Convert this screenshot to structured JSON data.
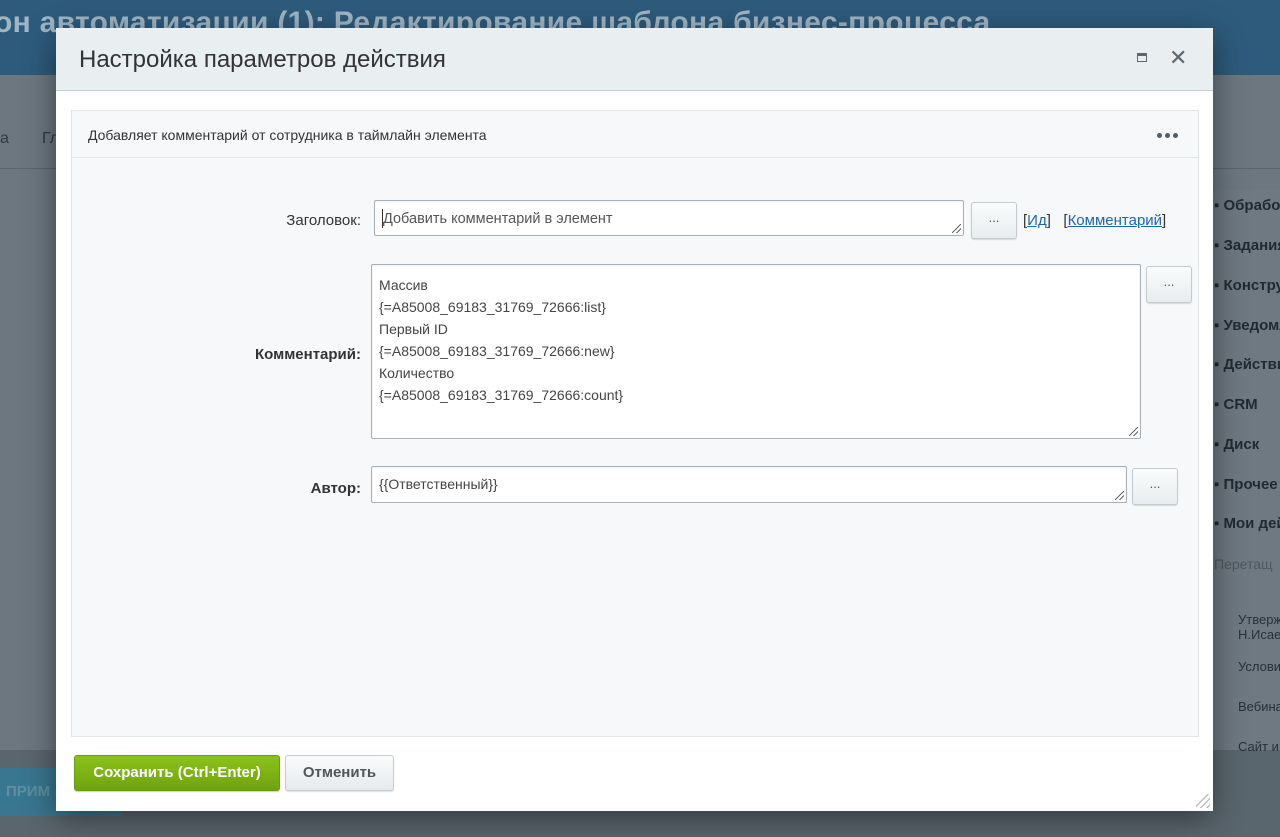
{
  "background": {
    "page_title": "он автоматизации (1): Редактирование шаблона бизнес-процесса",
    "tabs": [
      "а",
      "Гл"
    ],
    "apply_button": "ПРИМ",
    "right_sidebar": {
      "items": [
        "Обработ",
        "Задания",
        "Констру",
        "Уведомл",
        "Действи",
        "CRM",
        "Диск",
        "Прочее",
        "Мои дей"
      ],
      "drag_hint": "Перетащ",
      "bottom_items": [
        "Утверж Н.Исае",
        "Услови",
        "Вебина",
        "Сайт и"
      ]
    }
  },
  "dialog": {
    "title": "Настройка параметров действия",
    "description": "Добавляет комментарий от сотрудника в таймлайн элемента",
    "fields": {
      "title_label": "Заголовок:",
      "title_value": "Добавить комментарий в элемент",
      "title_links": [
        "Ид",
        "Комментарий"
      ],
      "comment_label": "Комментарий:",
      "comment_lines": [
        "Массив",
        "{=A85008_69183_31769_72666:list}",
        "Первый ID",
        "{=A85008_69183_31769_72666:new}",
        "Количество",
        "{=A85008_69183_31769_72666:count}"
      ],
      "author_label": "Автор:",
      "author_value": "{{Ответственный}}",
      "dots": "..."
    },
    "save_label": "Сохранить (Ctrl+Enter)",
    "cancel_label": "Отменить"
  }
}
